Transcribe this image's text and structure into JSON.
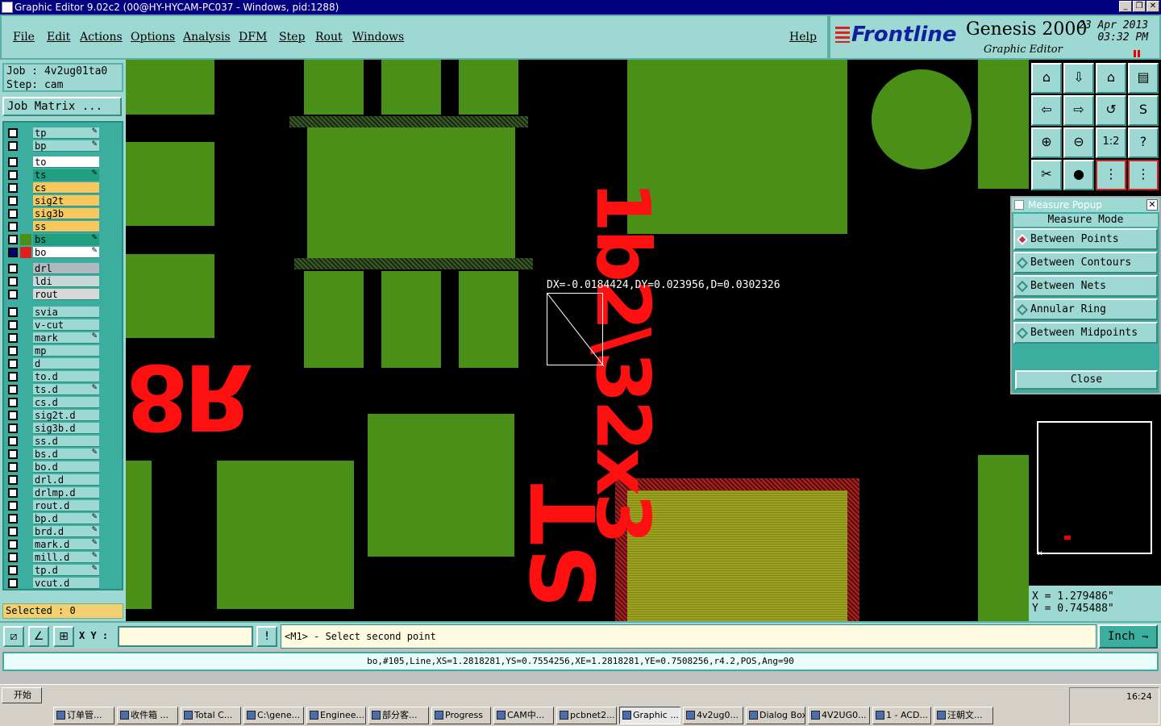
{
  "window": {
    "title": "Graphic Editor 9.02c2 (00@HY-HYCAM-PC037 - Windows, pid:1288)"
  },
  "menu": {
    "items": [
      "File",
      "Edit",
      "Actions",
      "Options",
      "Analysis",
      "DFM",
      "Step",
      "Rout",
      "Windows"
    ],
    "help": "Help"
  },
  "brand": {
    "logo": "Frontline",
    "product": "Genesis 2000",
    "subtitle": "Graphic Editor",
    "date": "23 Apr 2013",
    "time": "03:32 PM"
  },
  "job": {
    "job_line": "Job : 4v2ug01ta0",
    "step_line": "Step: cam",
    "matrix_button": "Job Matrix ..."
  },
  "layers": [
    {
      "name": "tp",
      "color": "#9ed8d2",
      "marker": true
    },
    {
      "name": "bp",
      "color": "#9ed8d2",
      "marker": true
    },
    {
      "name": "to",
      "color": "#ffffff",
      "marker": false
    },
    {
      "name": "ts",
      "color": "#20a080",
      "marker": true
    },
    {
      "name": "cs",
      "color": "#f8c860",
      "marker": false
    },
    {
      "name": "sig2t",
      "color": "#f8c860",
      "marker": false
    },
    {
      "name": "sig3b",
      "color": "#f8c860",
      "marker": false
    },
    {
      "name": "ss",
      "color": "#f8c860",
      "marker": false
    },
    {
      "name": "bs",
      "color": "#20a080",
      "marker": true
    },
    {
      "name": "bo",
      "color": "#ffffff",
      "marker": true
    },
    {
      "name": "drl",
      "color": "#b0b8c0",
      "marker": false
    },
    {
      "name": "ldi",
      "color": "#c8d8d8",
      "marker": false
    },
    {
      "name": "rout",
      "color": "#d8d8d8",
      "marker": false
    },
    {
      "name": "svia",
      "color": "#9ed8d2",
      "marker": false
    },
    {
      "name": "v-cut",
      "color": "#9ed8d2",
      "marker": false
    },
    {
      "name": "mark",
      "color": "#9ed8d2",
      "marker": true
    },
    {
      "name": "mp",
      "color": "#9ed8d2",
      "marker": false
    },
    {
      "name": "d",
      "color": "#9ed8d2",
      "marker": false
    },
    {
      "name": "to.d",
      "color": "#9ed8d2",
      "marker": false
    },
    {
      "name": "ts.d",
      "color": "#9ed8d2",
      "marker": true
    },
    {
      "name": "cs.d",
      "color": "#9ed8d2",
      "marker": false
    },
    {
      "name": "sig2t.d",
      "color": "#9ed8d2",
      "marker": false
    },
    {
      "name": "sig3b.d",
      "color": "#9ed8d2",
      "marker": false
    },
    {
      "name": "ss.d",
      "color": "#9ed8d2",
      "marker": false
    },
    {
      "name": "bs.d",
      "color": "#9ed8d2",
      "marker": true
    },
    {
      "name": "bo.d",
      "color": "#9ed8d2",
      "marker": false
    },
    {
      "name": "drl.d",
      "color": "#9ed8d2",
      "marker": false
    },
    {
      "name": "drlmp.d",
      "color": "#9ed8d2",
      "marker": false
    },
    {
      "name": "rout.d",
      "color": "#9ed8d2",
      "marker": false
    },
    {
      "name": "bp.d",
      "color": "#9ed8d2",
      "marker": true
    },
    {
      "name": "brd.d",
      "color": "#9ed8d2",
      "marker": true
    },
    {
      "name": "mark.d",
      "color": "#9ed8d2",
      "marker": true
    },
    {
      "name": "mill.d",
      "color": "#9ed8d2",
      "marker": true
    },
    {
      "name": "tp.d",
      "color": "#9ed8d2",
      "marker": true
    },
    {
      "name": "vcut.d",
      "color": "#9ed8d2",
      "marker": false
    }
  ],
  "selected": "Selected : 0",
  "canvas": {
    "measure_readout": "DX=-0.0184424,DY=0.023956,D=0.0302326",
    "silk_text_1": "8R",
    "silk_text_2": "ST",
    "silk_text_3": "1b2\\32x3"
  },
  "popup": {
    "title": "Measure Popup",
    "mode_label": "Measure Mode",
    "options": [
      {
        "label": "Between Points",
        "selected": true
      },
      {
        "label": "Between Contours",
        "selected": false
      },
      {
        "label": "Between Nets",
        "selected": false
      },
      {
        "label": "Annular Ring",
        "selected": false
      },
      {
        "label": "Between Midpoints",
        "selected": false
      }
    ],
    "close": "Close"
  },
  "coords": {
    "x": "X = 1.279486\"",
    "y": "Y = 0.745488\""
  },
  "bottom": {
    "xy_label": "X Y :",
    "xy_value": "",
    "prompt": "<M1> - Select second point",
    "unit": "Inch"
  },
  "status": "bo,#105,Line,XS=1.2818281,YS=0.7554256,XE=1.2818281,YE=0.7508256,r4.2,POS,Ang=90",
  "taskbar": {
    "start": "开始",
    "buttons": [
      "订单管...",
      "收件箱 ...",
      "Total C...",
      "C:\\gene...",
      "Enginee...",
      "部分客...",
      "Progress",
      "CAM中...",
      "pcbnet2...",
      "Graphic ...",
      "4v2ug0...",
      "Dialog Box",
      "4V2UG0...",
      "1 - ACD...",
      "汪朝文..."
    ],
    "active_index": 9,
    "clock": "16:24"
  }
}
